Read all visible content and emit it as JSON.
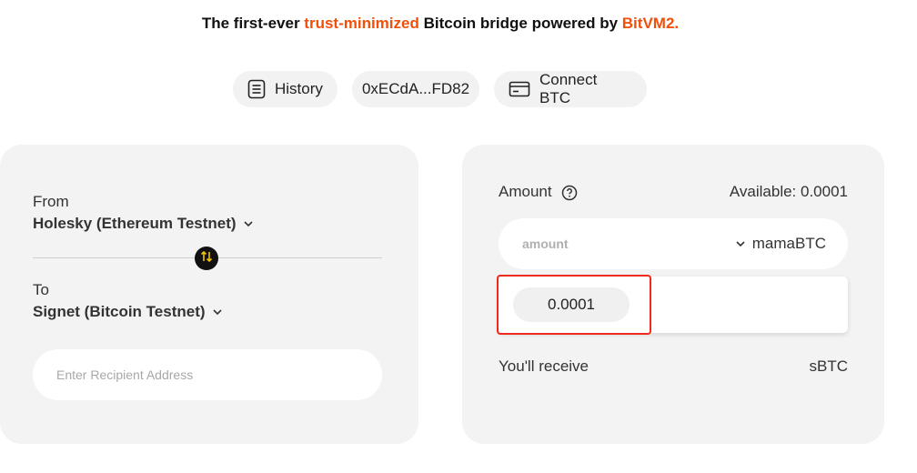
{
  "tagline": {
    "prefix": "The first-ever ",
    "highlight": "trust-minimized",
    "middle": " Bitcoin bridge powered by ",
    "brand": "BitVM2."
  },
  "toolbar": {
    "history_label": "History",
    "address_label": "0xECdA...FD82",
    "connect_label": "Connect BTC"
  },
  "bridge": {
    "from_label": "From",
    "from_network": "Holesky (Ethereum Testnet)",
    "to_label": "To",
    "to_network": "Signet (Bitcoin Testnet)",
    "recipient_placeholder": "Enter Recipient Address"
  },
  "amount_panel": {
    "amount_label": "Amount",
    "available_label": "Available: 0.0001",
    "amount_placeholder": "amount",
    "token": "mamaBTC",
    "suggestion_value": "0.0001",
    "receive_label": "You'll receive",
    "receive_token": "sBTC"
  },
  "colors": {
    "accent": "#f0500a",
    "highlight_border": "#ee2b1c",
    "swap_arrow": "#f5c400"
  }
}
